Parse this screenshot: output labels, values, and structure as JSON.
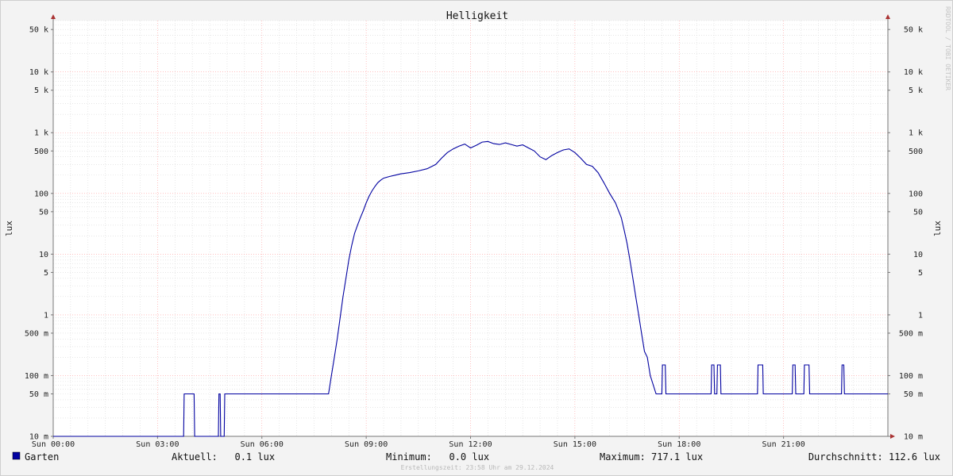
{
  "chart_data": {
    "type": "line",
    "title": "Helligkeit",
    "ylabel": "lux",
    "yscale": "log",
    "ylim": [
      0.01,
      70000
    ],
    "xlim": [
      "00:00",
      "24:00"
    ],
    "y_ticks": [
      {
        "value": 0.01,
        "label": "10 m"
      },
      {
        "value": 0.05,
        "label": "50 m"
      },
      {
        "value": 0.1,
        "label": "100 m"
      },
      {
        "value": 0.5,
        "label": "500 m"
      },
      {
        "value": 1,
        "label": "1"
      },
      {
        "value": 5,
        "label": "5"
      },
      {
        "value": 10,
        "label": "10"
      },
      {
        "value": 50,
        "label": "50"
      },
      {
        "value": 100,
        "label": "100"
      },
      {
        "value": 500,
        "label": "500"
      },
      {
        "value": 1000,
        "label": "1 k"
      },
      {
        "value": 5000,
        "label": "5 k"
      },
      {
        "value": 10000,
        "label": "10 k"
      },
      {
        "value": 50000,
        "label": "50 k"
      }
    ],
    "x_ticks": [
      {
        "value": "00:00",
        "label": "Sun 00:00"
      },
      {
        "value": "03:00",
        "label": "Sun 03:00"
      },
      {
        "value": "06:00",
        "label": "Sun 06:00"
      },
      {
        "value": "09:00",
        "label": "Sun 09:00"
      },
      {
        "value": "12:00",
        "label": "Sun 12:00"
      },
      {
        "value": "15:00",
        "label": "Sun 15:00"
      },
      {
        "value": "18:00",
        "label": "Sun 18:00"
      },
      {
        "value": "21:00",
        "label": "Sun 21:00"
      }
    ],
    "grid": true,
    "series": [
      {
        "name": "Garten",
        "color": "#0000a0",
        "points": [
          [
            "00:00",
            0.01
          ],
          [
            "03:45",
            0.01
          ],
          [
            "03:46",
            0.05
          ],
          [
            "04:03",
            0.05
          ],
          [
            "04:04",
            0.01
          ],
          [
            "04:45",
            0.01
          ],
          [
            "04:46",
            0.05
          ],
          [
            "04:48",
            0.05
          ],
          [
            "04:49",
            0.01
          ],
          [
            "04:55",
            0.01
          ],
          [
            "04:56",
            0.05
          ],
          [
            "07:55",
            0.05
          ],
          [
            "08:00",
            0.1
          ],
          [
            "08:05",
            0.2
          ],
          [
            "08:10",
            0.4
          ],
          [
            "08:15",
            0.9
          ],
          [
            "08:20",
            2
          ],
          [
            "08:25",
            4
          ],
          [
            "08:30",
            8
          ],
          [
            "08:35",
            14
          ],
          [
            "08:40",
            22
          ],
          [
            "08:45",
            30
          ],
          [
            "08:50",
            40
          ],
          [
            "08:55",
            52
          ],
          [
            "09:00",
            70
          ],
          [
            "09:05",
            90
          ],
          [
            "09:10",
            110
          ],
          [
            "09:15",
            130
          ],
          [
            "09:20",
            150
          ],
          [
            "09:25",
            165
          ],
          [
            "09:30",
            178
          ],
          [
            "09:40",
            190
          ],
          [
            "09:50",
            200
          ],
          [
            "10:00",
            210
          ],
          [
            "10:15",
            220
          ],
          [
            "10:30",
            235
          ],
          [
            "10:45",
            255
          ],
          [
            "11:00",
            300
          ],
          [
            "11:10",
            380
          ],
          [
            "11:20",
            470
          ],
          [
            "11:30",
            540
          ],
          [
            "11:40",
            600
          ],
          [
            "11:50",
            650
          ],
          [
            "12:00",
            560
          ],
          [
            "12:10",
            620
          ],
          [
            "12:20",
            700
          ],
          [
            "12:30",
            717
          ],
          [
            "12:40",
            660
          ],
          [
            "12:50",
            640
          ],
          [
            "13:00",
            680
          ],
          [
            "13:10",
            640
          ],
          [
            "13:20",
            600
          ],
          [
            "13:30",
            630
          ],
          [
            "13:40",
            560
          ],
          [
            "13:50",
            500
          ],
          [
            "14:00",
            400
          ],
          [
            "14:10",
            360
          ],
          [
            "14:20",
            420
          ],
          [
            "14:30",
            470
          ],
          [
            "14:40",
            520
          ],
          [
            "14:50",
            540
          ],
          [
            "15:00",
            470
          ],
          [
            "15:10",
            380
          ],
          [
            "15:20",
            300
          ],
          [
            "15:30",
            280
          ],
          [
            "15:40",
            220
          ],
          [
            "15:50",
            150
          ],
          [
            "16:00",
            100
          ],
          [
            "16:10",
            70
          ],
          [
            "16:20",
            40
          ],
          [
            "16:25",
            25
          ],
          [
            "16:30",
            15
          ],
          [
            "16:35",
            8
          ],
          [
            "16:40",
            4
          ],
          [
            "16:45",
            2
          ],
          [
            "16:50",
            1
          ],
          [
            "16:55",
            0.5
          ],
          [
            "17:00",
            0.25
          ],
          [
            "17:05",
            0.2
          ],
          [
            "17:10",
            0.1
          ],
          [
            "17:20",
            0.05
          ],
          [
            "17:30",
            0.05
          ],
          [
            "17:31",
            0.15
          ],
          [
            "17:36",
            0.15
          ],
          [
            "17:37",
            0.05
          ],
          [
            "18:55",
            0.05
          ],
          [
            "18:56",
            0.15
          ],
          [
            "19:00",
            0.15
          ],
          [
            "19:01",
            0.05
          ],
          [
            "19:05",
            0.05
          ],
          [
            "19:06",
            0.15
          ],
          [
            "19:11",
            0.15
          ],
          [
            "19:12",
            0.05
          ],
          [
            "20:15",
            0.05
          ],
          [
            "20:16",
            0.15
          ],
          [
            "20:24",
            0.15
          ],
          [
            "20:25",
            0.05
          ],
          [
            "21:15",
            0.05
          ],
          [
            "21:16",
            0.15
          ],
          [
            "21:20",
            0.15
          ],
          [
            "21:21",
            0.05
          ],
          [
            "21:35",
            0.05
          ],
          [
            "21:36",
            0.15
          ],
          [
            "21:44",
            0.15
          ],
          [
            "21:45",
            0.05
          ],
          [
            "22:40",
            0.05
          ],
          [
            "22:41",
            0.15
          ],
          [
            "22:44",
            0.15
          ],
          [
            "22:45",
            0.05
          ],
          [
            "24:00",
            0.05
          ]
        ]
      }
    ]
  },
  "legend": {
    "series_label": "Garten",
    "swatch_color": "#0000a0",
    "current": "Aktuell:   0.1 lux",
    "minimum": "Minimum:   0.0 lux",
    "maximum": "Maximum: 717.1 lux",
    "average": "Durchschnitt: 112.6 lux"
  },
  "footer": "Erstellungszeit: 23:58 Uhr am 29.12.2024",
  "watermark": "RRDTOOL / TOBI OETIKER"
}
